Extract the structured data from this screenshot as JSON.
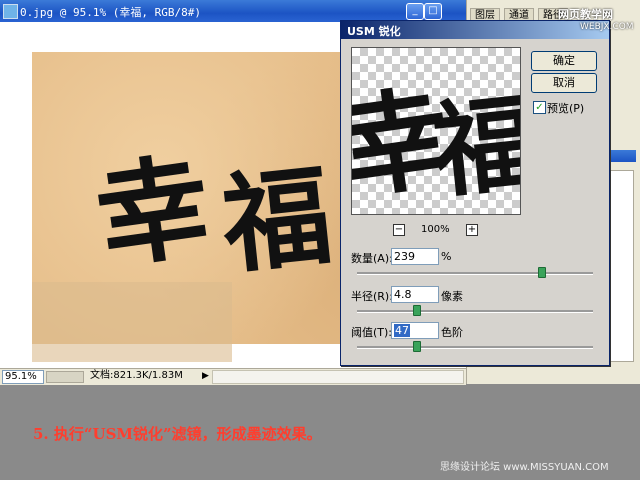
{
  "document": {
    "title": "0.jpg @ 95.1% (幸福, RGB/8#)",
    "zoom": "95.1%",
    "doc_info": "文档:821.3K/1.83M",
    "status_arrow": "▶",
    "calligraphy_chars": [
      "幸",
      "福"
    ]
  },
  "palette": {
    "tabs": [
      "图层",
      "通道",
      "路径"
    ]
  },
  "dialog": {
    "title": "USM 锐化",
    "ok_label": "确定",
    "cancel_label": "取消",
    "preview_label": "预览(P)",
    "preview_checked": true,
    "check_mark": "✓",
    "zoom_label": "100%",
    "zoom_minus": "−",
    "zoom_plus": "+",
    "preview_chars": [
      "幸",
      "福"
    ],
    "fields": {
      "amount": {
        "label": "数量(A):",
        "value": "239",
        "unit": "%",
        "slider_fraction": 0.78
      },
      "radius": {
        "label": "半径(R):",
        "value": "4.8",
        "unit": "像素",
        "slider_fraction": 0.25
      },
      "threshold": {
        "label": "阈值(T):",
        "value": "47",
        "unit": "色阶",
        "slider_fraction": 0.25
      }
    }
  },
  "caption": "5. 执行“USM锐化”滤镜，形成墨迹效果。",
  "watermarks": {
    "top_right": "网页教学网",
    "top_right_sub": "WEBJX.COM",
    "bottom_right": "思缘设计论坛 www.MISSYUAN.COM"
  },
  "colors": {
    "title_bar": "#1c54c4",
    "paper": "#e6be8a",
    "caption": "#ff3e2e",
    "thumb": "#3aa35a"
  }
}
